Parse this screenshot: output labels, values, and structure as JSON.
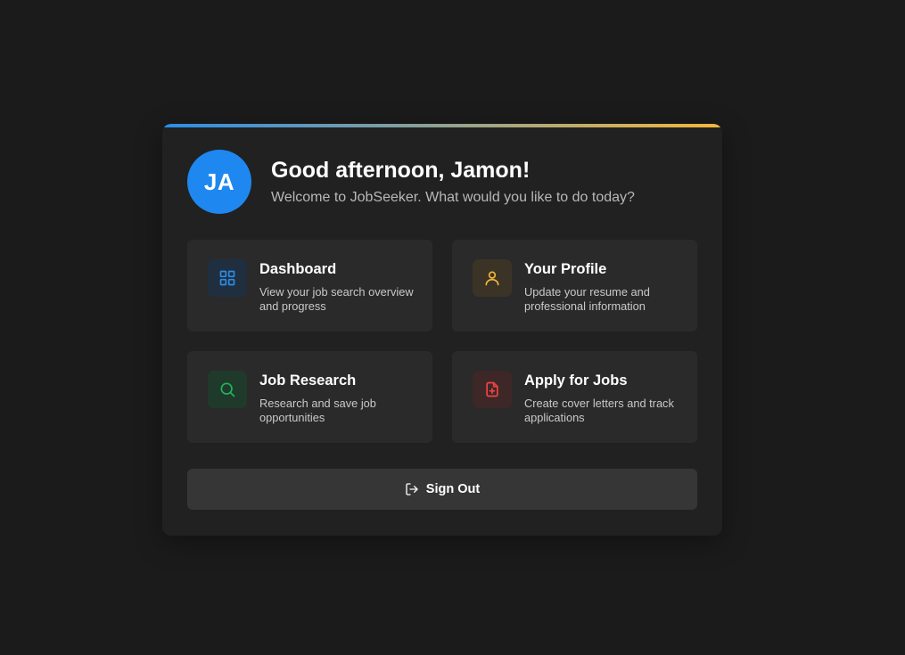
{
  "theme": {
    "background": "#1b1b1b",
    "card": "#212121",
    "tile": "#2a2a2a",
    "accent_gradient": [
      "#2b8de8",
      "#f6b73c"
    ],
    "avatar_color": "#1e88f0"
  },
  "header": {
    "avatar_initials": "JA",
    "greeting": "Good afternoon, Jamon!",
    "subtitle": "Welcome to JobSeeker. What would you like to do today?"
  },
  "tiles": [
    {
      "title": "Dashboard",
      "description": "View your job search overview and progress",
      "icon": "grid-icon",
      "color": "#2b8de8",
      "icon_bg": "#1f2f40"
    },
    {
      "title": "Your Profile",
      "description": "Update your resume and professional information",
      "icon": "user-icon",
      "color": "#f6b73c",
      "icon_bg": "#3b3326"
    },
    {
      "title": "Job Research",
      "description": "Research and save job opportunities",
      "icon": "search-icon",
      "color": "#22b35a",
      "icon_bg": "#1f3a2b"
    },
    {
      "title": "Apply for Jobs",
      "description": "Create cover letters and track applications",
      "icon": "file-plus-icon",
      "color": "#ef4444",
      "icon_bg": "#3d2727"
    }
  ],
  "signout": {
    "label": "Sign Out",
    "icon": "sign-out-icon"
  }
}
